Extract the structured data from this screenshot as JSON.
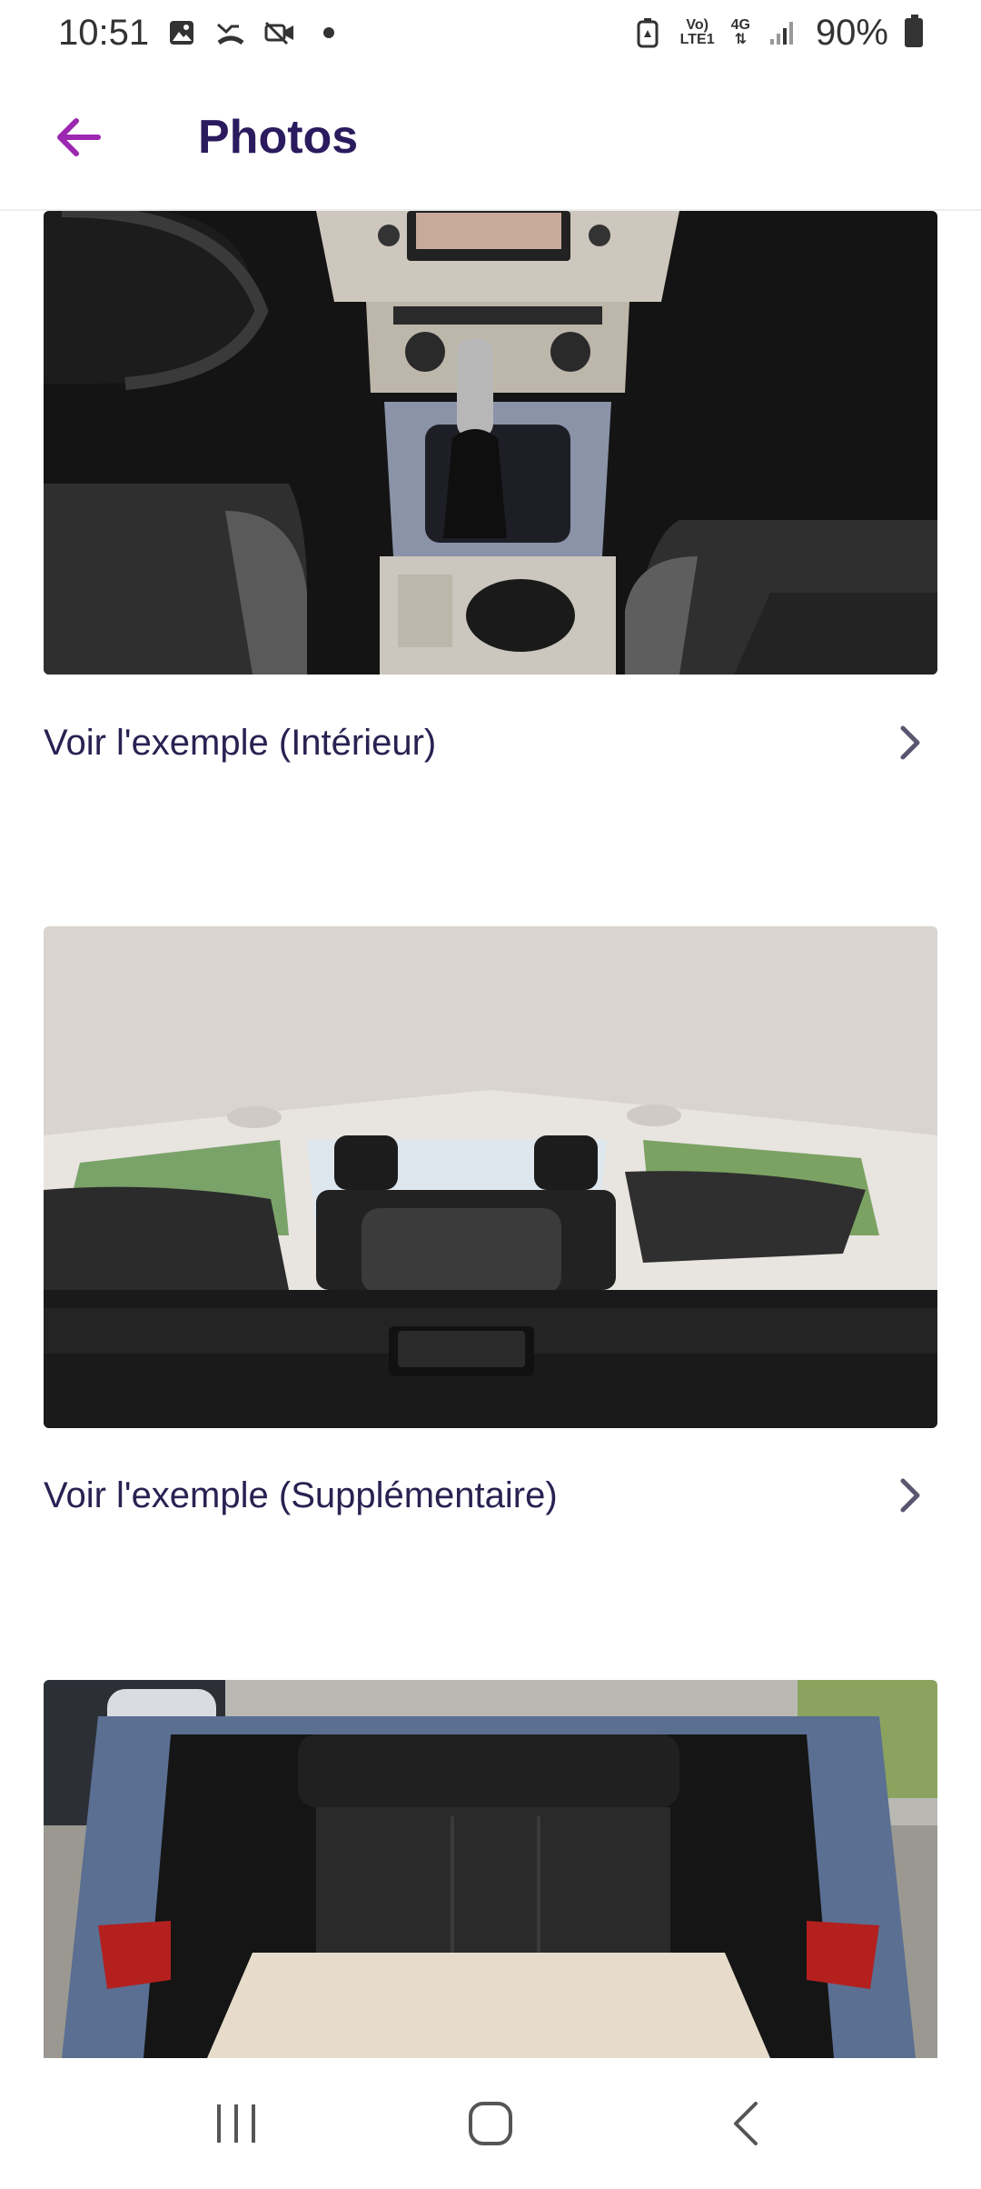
{
  "status_bar": {
    "time": "10:51",
    "net_top": "Vo)",
    "net_bottom": "LTE1",
    "net_type": "4G",
    "battery": "90%",
    "icons": [
      "gallery-icon",
      "missed-call-icon",
      "video-off-icon",
      "dot-icon",
      "battery-saver-icon",
      "signal-icon",
      "battery-icon"
    ]
  },
  "header": {
    "title": "Photos",
    "back_icon": "arrow-left-icon",
    "accent_color": "#9c27b0"
  },
  "main": {
    "sections": [
      {
        "image": "car-interior-center-console-photo",
        "label": "Voir l'exemple (Intérieur)"
      },
      {
        "image": "car-rear-seats-photo",
        "label": "Voir l'exemple (Supplémentaire)"
      },
      {
        "image": "car-open-trunk-photo",
        "label": ""
      }
    ]
  },
  "nav_bar": {
    "buttons": [
      "recent-apps-icon",
      "home-icon",
      "back-icon"
    ]
  }
}
